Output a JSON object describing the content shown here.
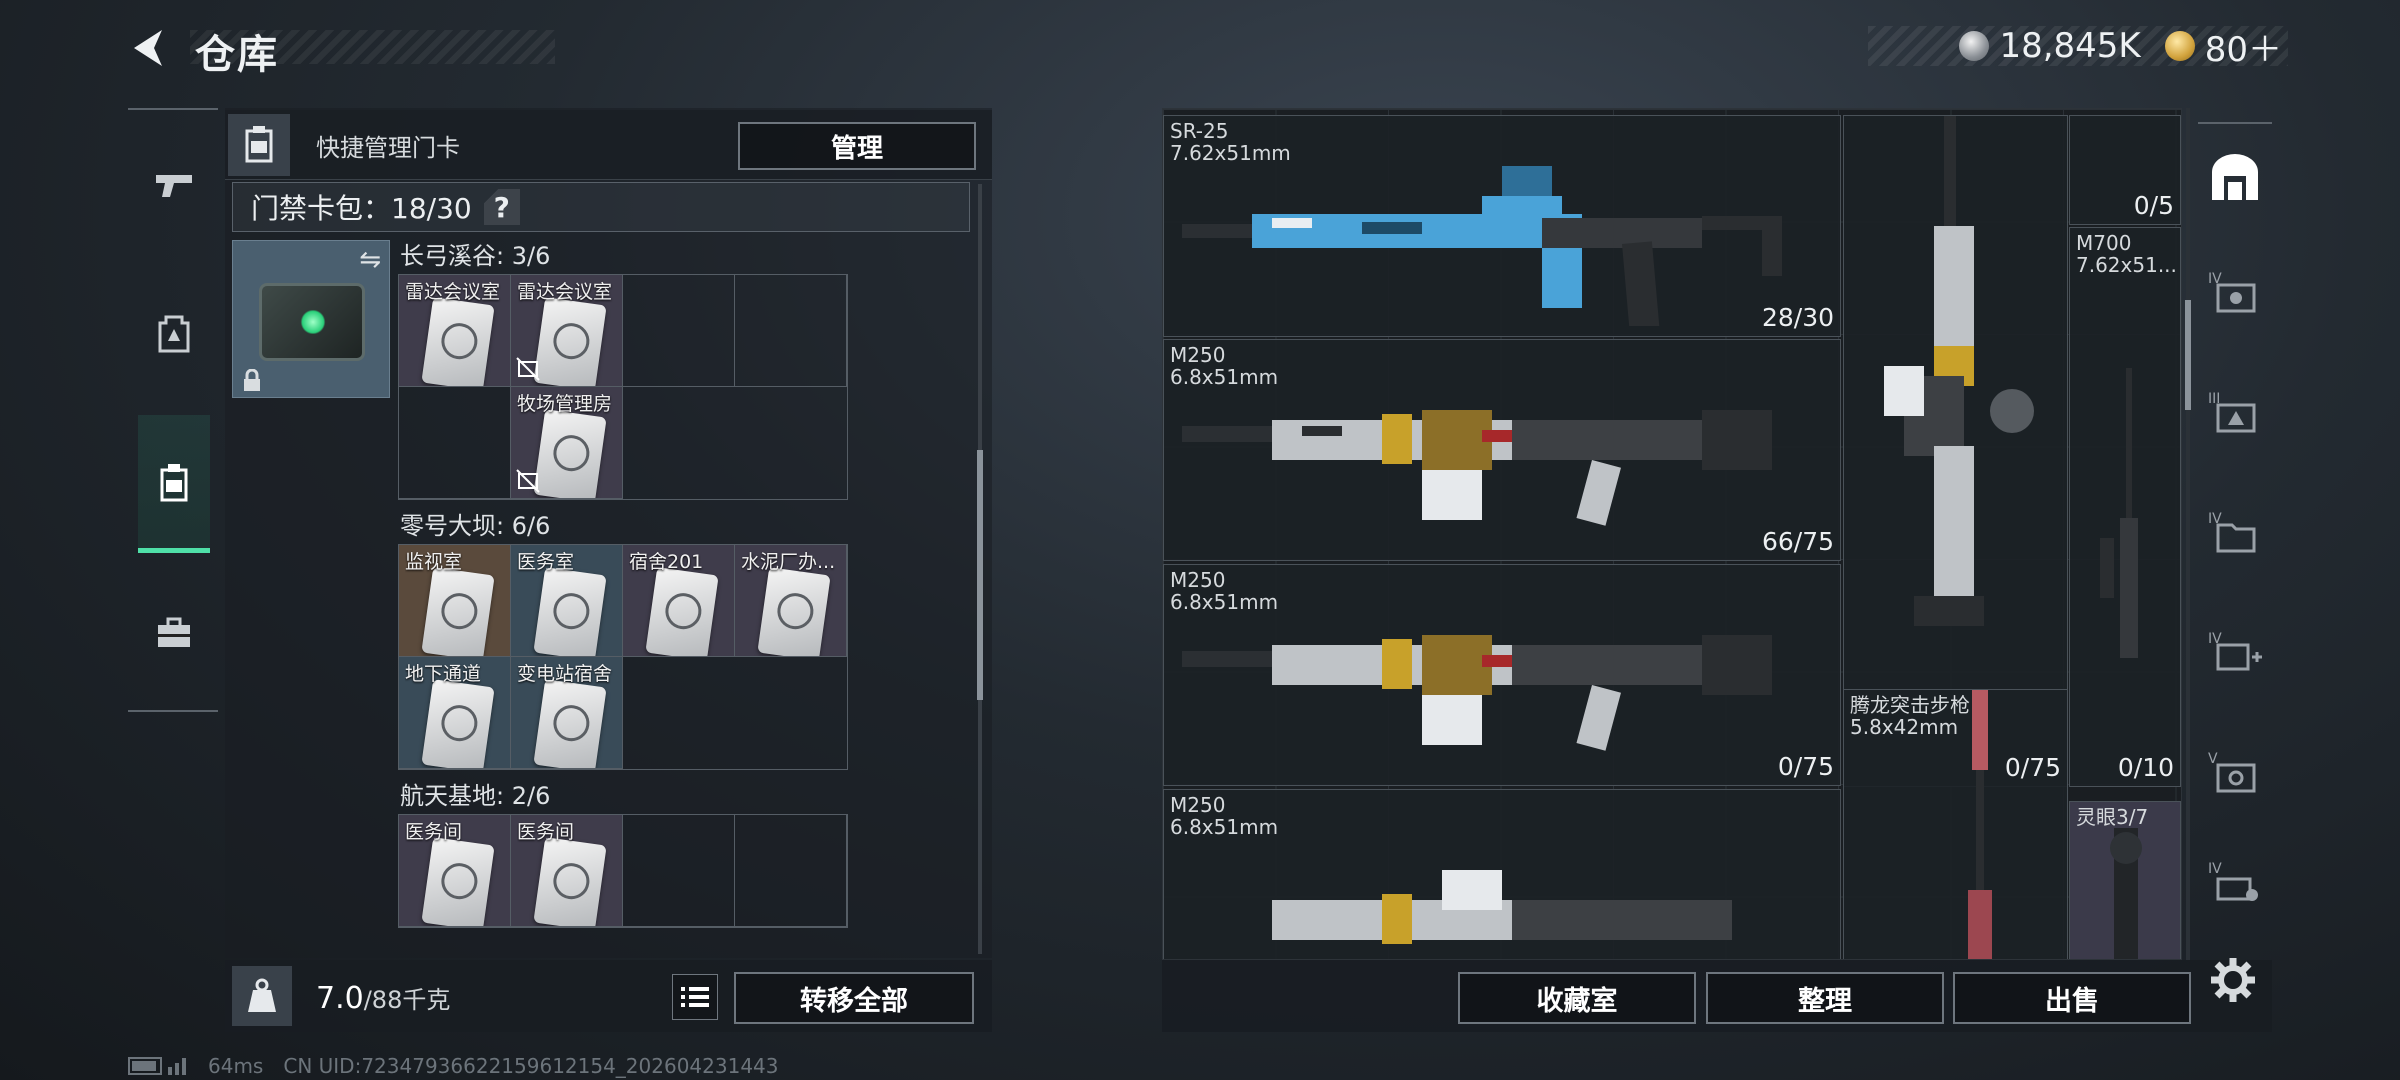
{
  "header": {
    "title": "仓库"
  },
  "currency": {
    "silver_value": "18,845K",
    "gold_value": "80＋"
  },
  "keycard_panel": {
    "quick_manage_label": "快捷管理门卡",
    "manage_button": "管理",
    "card_pack_label": "门禁卡包：18/30",
    "help_symbol": "?",
    "groups": [
      {
        "title": "长弓溪谷: 3/6",
        "slots": [
          {
            "label": "雷达会议室",
            "filled": true,
            "no_trade": false
          },
          {
            "label": "雷达会议室",
            "filled": true,
            "no_trade": true
          },
          {
            "label": "",
            "filled": false
          },
          {
            "label": "",
            "filled": false
          },
          {
            "label": "",
            "filled": false
          },
          {
            "label": "牧场管理房",
            "filled": true,
            "no_trade": true
          }
        ]
      },
      {
        "title": "零号大坝: 6/6",
        "slots": [
          {
            "label": "监视室",
            "filled": true
          },
          {
            "label": "医务室",
            "filled": true
          },
          {
            "label": "宿舍201",
            "filled": true
          },
          {
            "label": "水泥厂办...",
            "filled": true
          },
          {
            "label": "地下通道",
            "filled": true
          },
          {
            "label": "变电站宿舍",
            "filled": true
          }
        ]
      },
      {
        "title": "航天基地: 2/6",
        "slots": [
          {
            "label": "医务间",
            "filled": true
          },
          {
            "label": "医务间",
            "filled": true
          },
          {
            "label": "",
            "filled": false
          },
          {
            "label": "",
            "filled": false
          }
        ]
      }
    ]
  },
  "bottom_left": {
    "weight_current": "7.0",
    "weight_max": "/88千克",
    "transfer_all": "转移全部"
  },
  "status": {
    "ping": "64ms",
    "uid": "CN UID:72347936622159612154_202604231443"
  },
  "storage_items": [
    {
      "name": "SR-25",
      "caliber": "7.62x51mm",
      "ammo": "28/30"
    },
    {
      "name": "M250",
      "caliber": "6.8x51mm",
      "ammo": "66/75"
    },
    {
      "name": "M250",
      "caliber": "6.8x51mm",
      "ammo": "0/75"
    },
    {
      "name": "M250",
      "caliber": "6.8x51mm",
      "ammo": ""
    },
    {
      "name": "",
      "caliber": "",
      "ammo": "0/5"
    },
    {
      "name": "",
      "caliber": "",
      "ammo": "0/75"
    },
    {
      "name": "M700",
      "caliber": "7.62x51...",
      "ammo": "0/10"
    },
    {
      "name": "腾龙突击步枪",
      "caliber": "5.8x42mm",
      "ammo": ""
    },
    {
      "name": "灵眼3/7",
      "caliber": "",
      "ammo": ""
    }
  ],
  "bottom_right": {
    "collection_button": "收藏室",
    "sort_button": "整理",
    "sell_button": "出售"
  }
}
